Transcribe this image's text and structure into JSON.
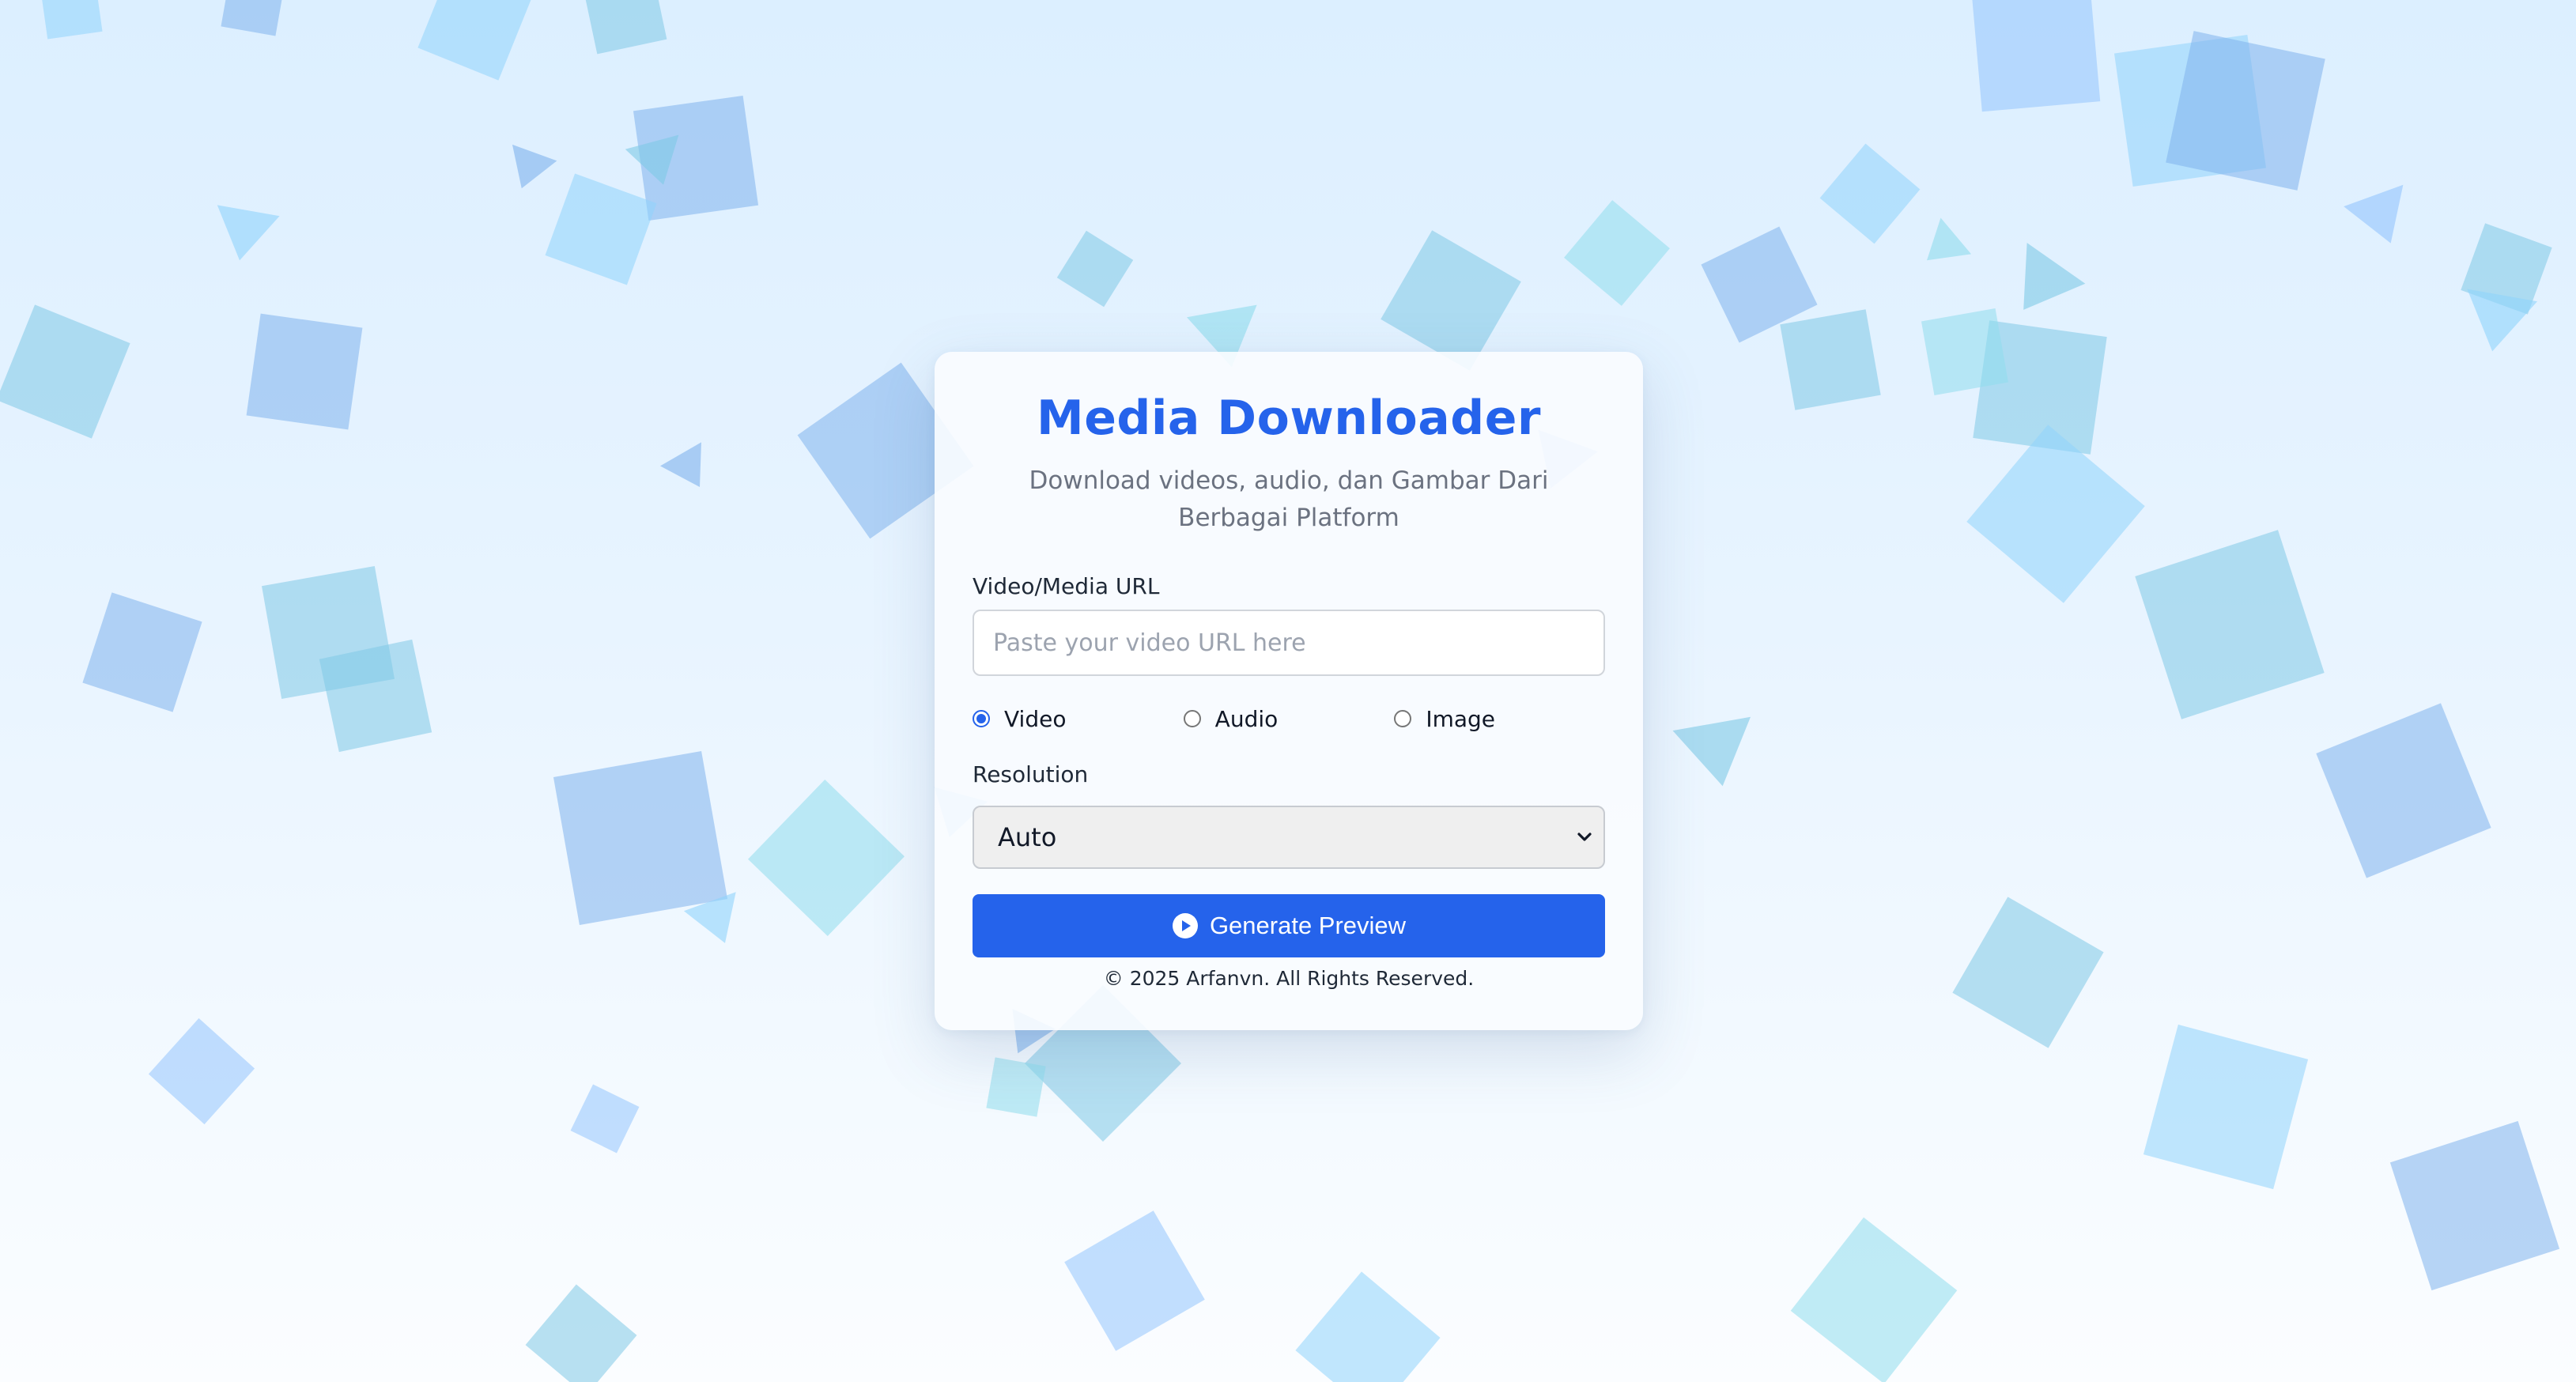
{
  "app": {
    "title": "Media Downloader",
    "subtitle": "Download videos, audio, dan Gambar Dari Berbagai Platform"
  },
  "form": {
    "url_label": "Video/Media URL",
    "url_value": "",
    "url_placeholder": "Paste your video URL here",
    "media_types": [
      {
        "label": "Video",
        "checked": true
      },
      {
        "label": "Audio",
        "checked": false
      },
      {
        "label": "Image",
        "checked": false
      }
    ],
    "resolution_label": "Resolution",
    "resolution_selected": "Auto",
    "submit_label": "Generate Preview",
    "submit_icon": "play-circle-icon"
  },
  "footer": {
    "copyright": "© 2025 Arfanvn. All Rights Reserved."
  },
  "colors": {
    "accent": "#2563eb",
    "background": "#e6f3ff",
    "decor_shapes": [
      "#8fd3fb",
      "#7fb2ec",
      "#7fc9e6",
      "#8fdcec",
      "#93c5fd"
    ]
  }
}
